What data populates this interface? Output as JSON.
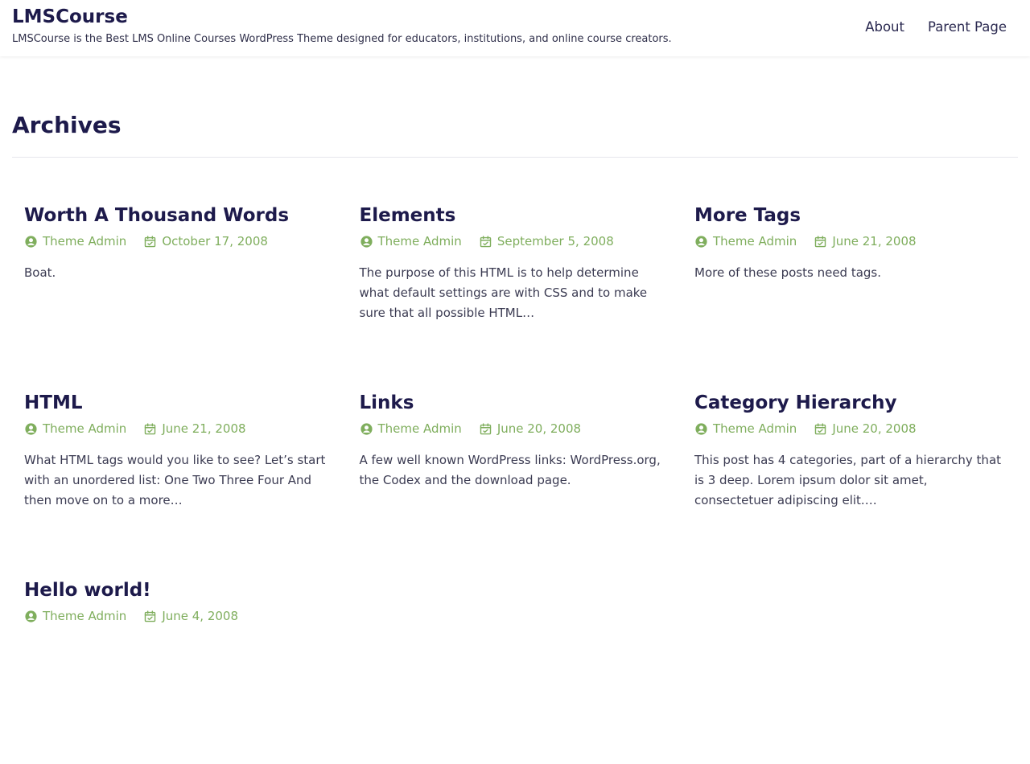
{
  "header": {
    "site_title": "LMSCourse",
    "tagline": "LMSCourse is the Best LMS Online Courses WordPress Theme designed for educators, institutions, and online course creators.",
    "nav": [
      {
        "label": "About"
      },
      {
        "label": "Parent Page"
      }
    ]
  },
  "page": {
    "heading": "Archives"
  },
  "colors": {
    "heading": "#1d1a4b",
    "meta": "#7fae5d",
    "text": "#3b3b52"
  },
  "posts": [
    {
      "title": "Worth A Thousand Words",
      "author": "Theme Admin",
      "date": "October 17, 2008",
      "excerpt": "Boat.",
      "author_icon": "user-circle-icon",
      "date_icon": "calendar-icon"
    },
    {
      "title": "Elements",
      "author": "Theme Admin",
      "date": "September 5, 2008",
      "excerpt": "The purpose of this HTML is to help determine what default settings are with CSS and to make sure that all possible HTML…",
      "author_icon": "user-circle-icon",
      "date_icon": "calendar-icon"
    },
    {
      "title": "More Tags",
      "author": "Theme Admin",
      "date": "June 21, 2008",
      "excerpt": "More of these posts need tags.",
      "author_icon": "user-circle-icon",
      "date_icon": "calendar-icon"
    },
    {
      "title": "HTML",
      "author": "Theme Admin",
      "date": "June 21, 2008",
      "excerpt": "What HTML tags would you like to see? Let’s start with an unordered list: One Two Three Four And then move on to a more…",
      "author_icon": "user-circle-icon",
      "date_icon": "calendar-icon"
    },
    {
      "title": "Links",
      "author": "Theme Admin",
      "date": "June 20, 2008",
      "excerpt": "A few well known WordPress links: WordPress.org, the Codex and the download page.",
      "author_icon": "user-circle-icon",
      "date_icon": "calendar-icon"
    },
    {
      "title": "Category Hierarchy",
      "author": "Theme Admin",
      "date": "June 20, 2008",
      "excerpt": "This post has 4 categories, part of a hierarchy that is 3 deep. Lorem ipsum dolor sit amet, consectetuer adipiscing elit.…",
      "author_icon": "user-circle-icon",
      "date_icon": "calendar-icon"
    },
    {
      "title": "Hello world!",
      "author": "Theme Admin",
      "date": "June 4, 2008",
      "excerpt": "",
      "author_icon": "user-circle-icon",
      "date_icon": "calendar-icon"
    }
  ]
}
